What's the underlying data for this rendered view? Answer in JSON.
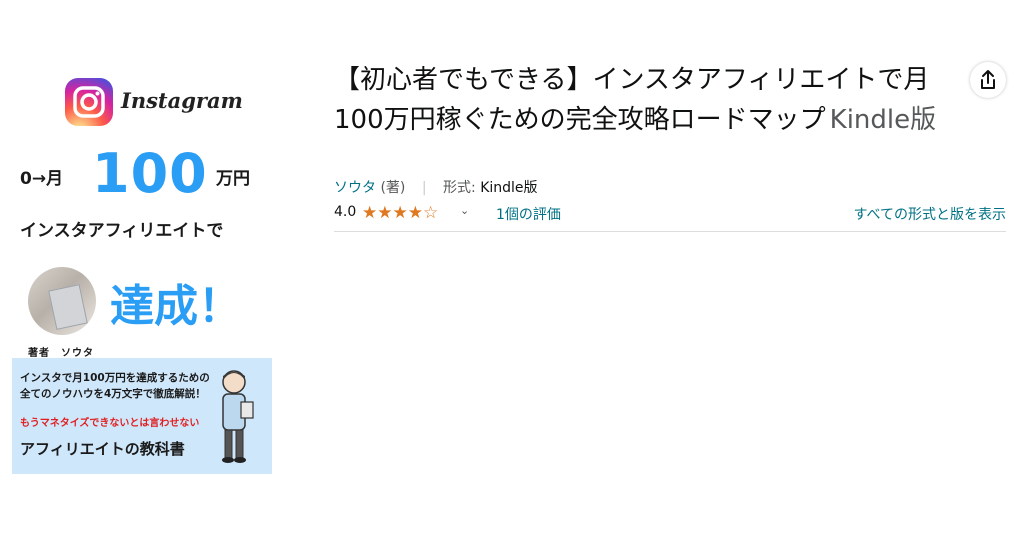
{
  "cover": {
    "instagram_word": "Instagram",
    "prefix": "0→月",
    "amount": "100",
    "unit": "万円",
    "line2": "インスタアフィリエイトで",
    "achieve": "達成！",
    "author_caption": "著者　ソウタ",
    "box_line1": "インスタで月100万円を達成するための",
    "box_line2": "全てのノウハウを4万文字で徹底解説！",
    "box_red": "もうマネタイズできないとは言わせない",
    "box_title": "アフィリエイトの教科書",
    "accent_color": "#2a9df4",
    "box_bg": "#cfe7fb"
  },
  "product": {
    "title": "【初心者でもできる】インスタアフィリエイトで月100万円稼ぐための完全攻略ロードマップ",
    "format_suffix": "Kindle版",
    "author": "ソウタ",
    "author_role": "(著)",
    "format_label": "形式:",
    "format_value": "Kindle版",
    "rating_score": "4.0",
    "rating_value": 4.0,
    "stars": "★★★★☆",
    "rating_count": "1個の評価",
    "all_formats_link": "すべての形式と版を表示",
    "star_color": "#de7921",
    "link_color": "#007185"
  },
  "icons": {
    "share": "share-icon",
    "dropdown": "chevron-down-icon",
    "instagram": "instagram-logo"
  }
}
